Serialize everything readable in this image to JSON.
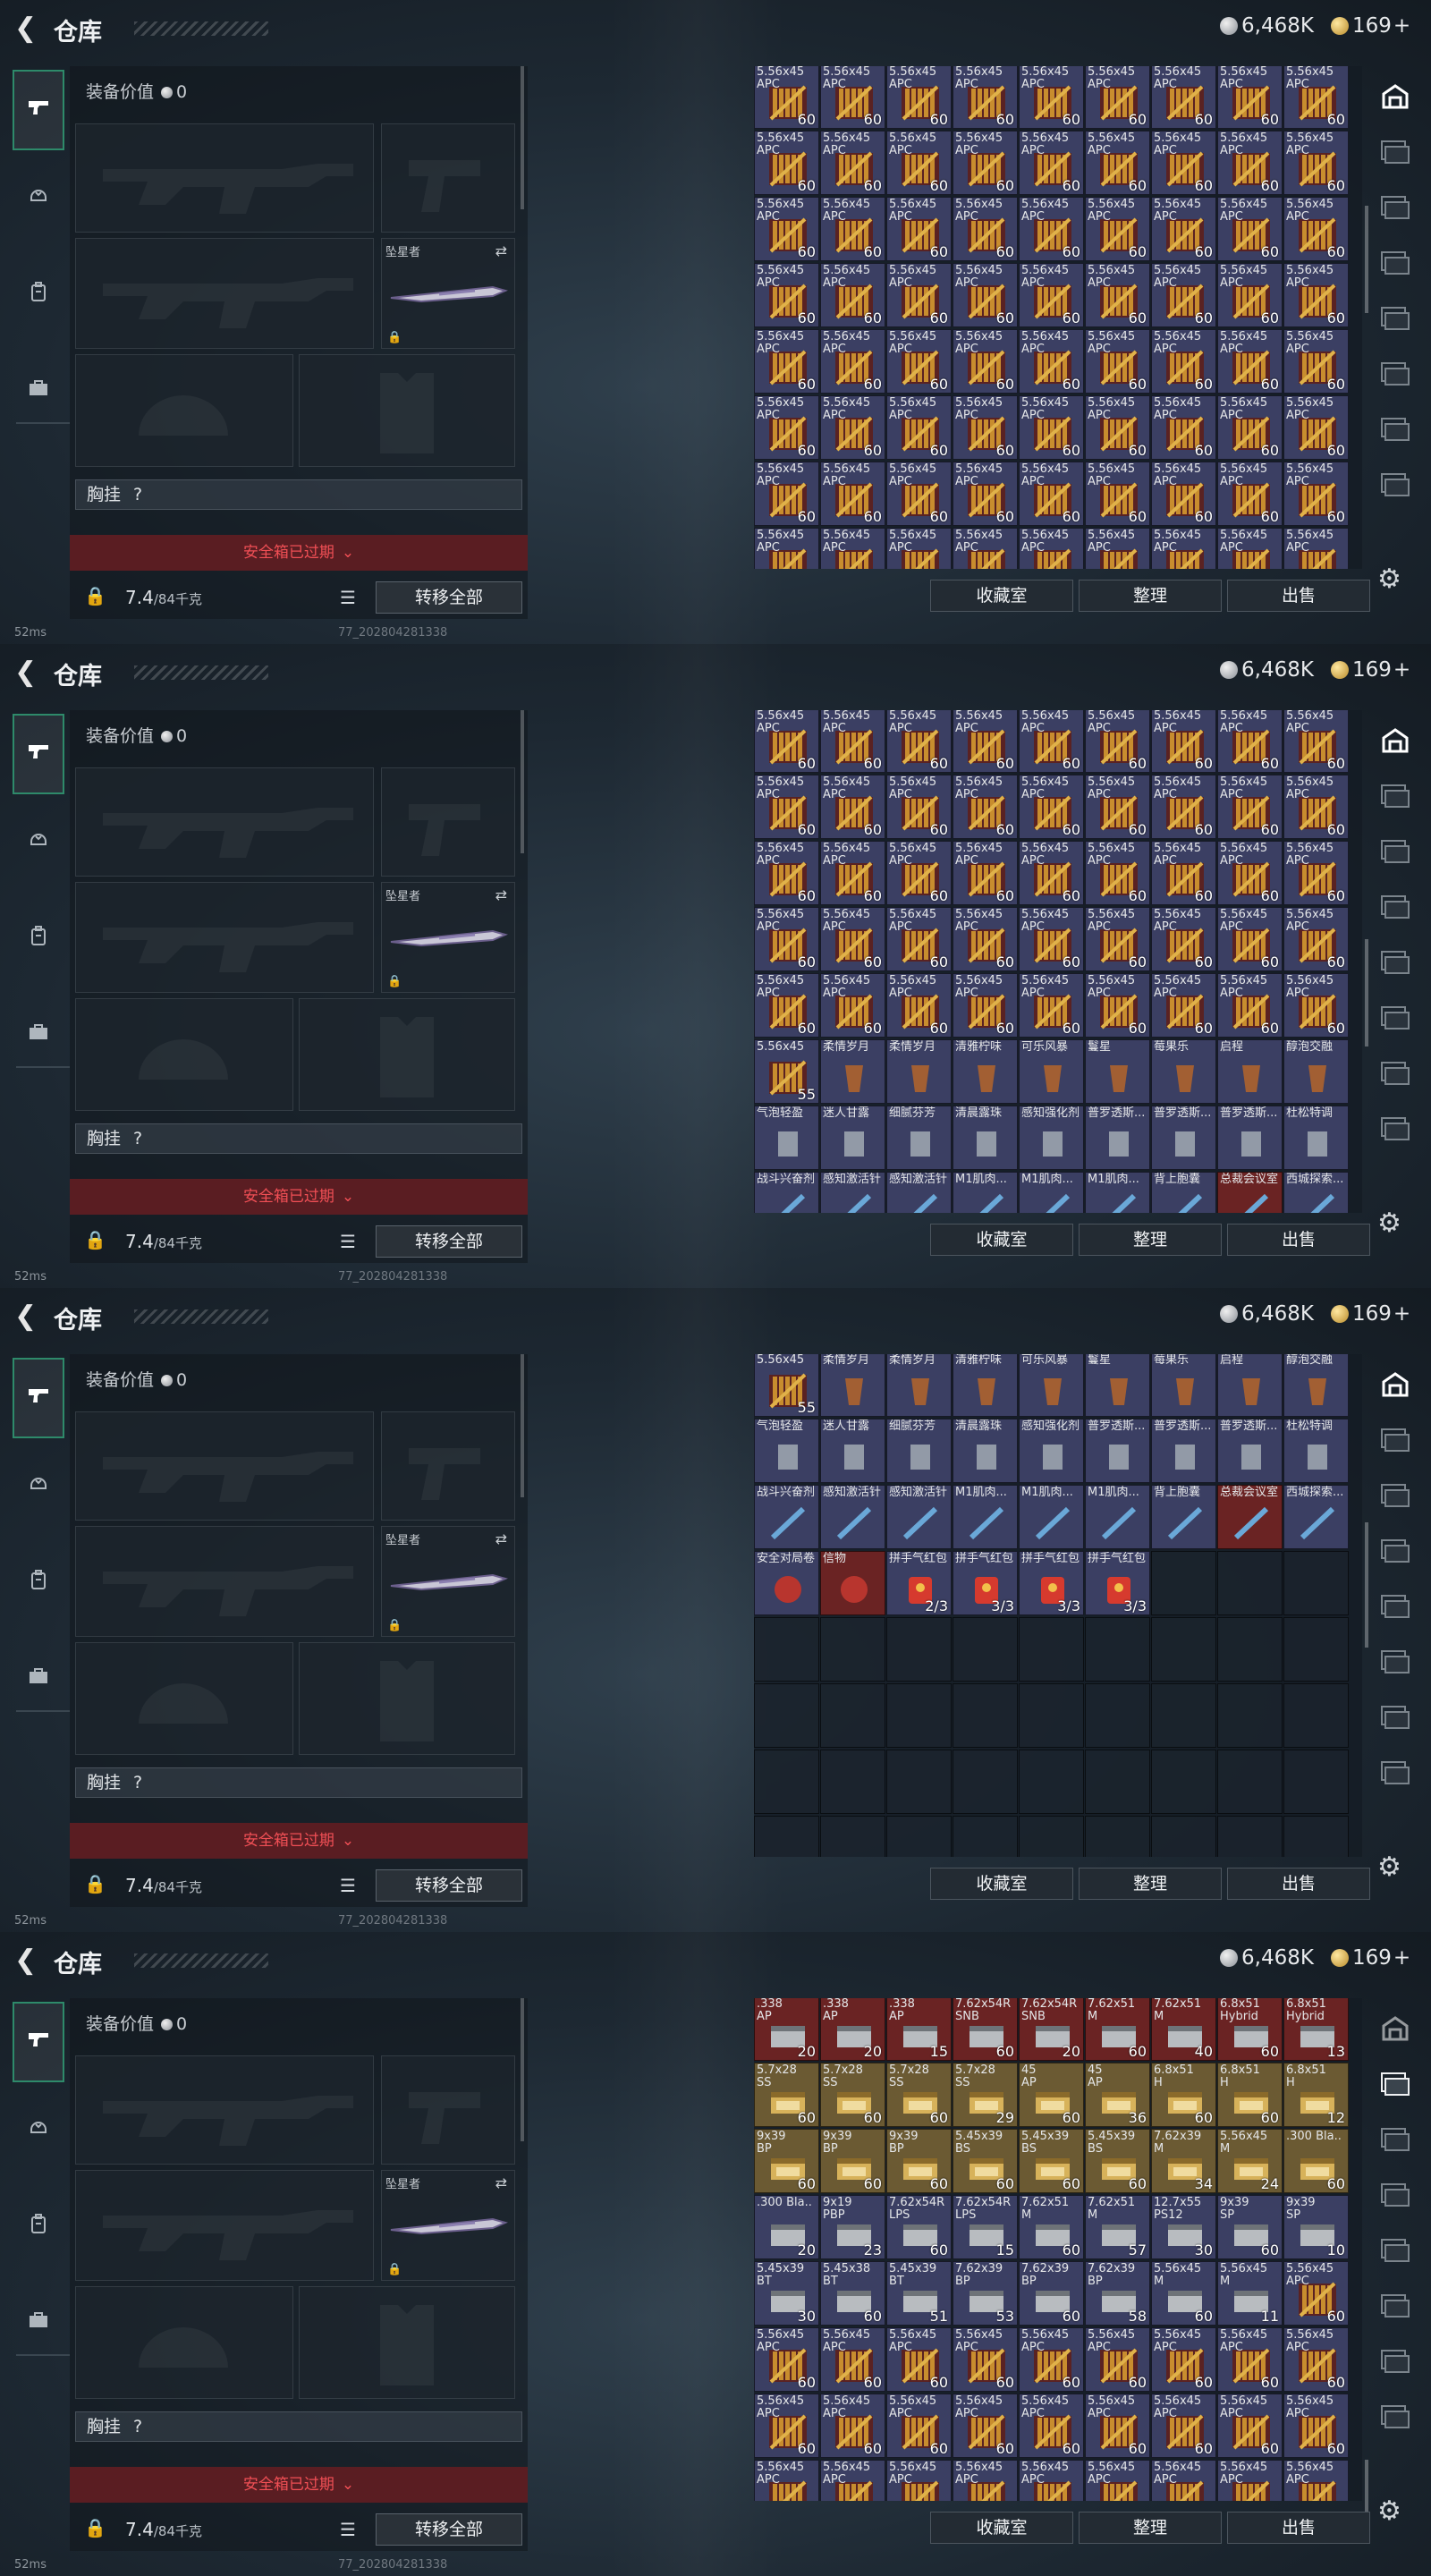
{
  "header": {
    "title": "仓库",
    "silver_amount": "6,468K",
    "gold_amount": "169",
    "gold_plus": "+"
  },
  "equipment": {
    "value_label": "装备价值",
    "value_amount": "0",
    "melee_name": "坠星者",
    "chest_label": "胸挂",
    "chest_help": "?",
    "safebox_text": "安全箱已过期",
    "weight_current": "7.4",
    "weight_max": "/84千克",
    "transfer_all": "转移全部"
  },
  "actions": {
    "collection": "收藏室",
    "organize": "整理",
    "sell": "出售"
  },
  "footer": {
    "ping": "52ms",
    "version": "77_202804281338"
  },
  "ammo": {
    "name_line1": "5.56x45",
    "name_line2": "APC",
    "count_60": "60",
    "count_55": "55"
  },
  "colors": {
    "safebox_bg": "#5a1d22",
    "safebox_text": "#f04f55",
    "active_nav_border": "#2e8a6a",
    "ammo_cell_bg": "#3b3f63",
    "rare_red_bg": "#6a2323",
    "rare_gold_bg": "#6b5a33",
    "rare_green_bg": "#3f5a2e"
  },
  "left_nav_icons": [
    "gun-icon",
    "helmet-icon",
    "backpack-icon",
    "briefcase-icon"
  ],
  "right_rail_icons": [
    "warehouse-icon",
    "cabinet-icon-1",
    "cabinet-icon-2",
    "cabinet-icon-3",
    "cabinet-icon-4",
    "cabinet-icon-5",
    "cabinet-icon-6",
    "cabinet-icon-7"
  ],
  "panel2": {
    "consumables_row1": [
      {
        "name": "5.56x45",
        "count": "55"
      },
      {
        "name": "柔情岁月"
      },
      {
        "name": "柔情岁月"
      },
      {
        "name": "清雅柠味"
      },
      {
        "name": "可乐风暴"
      },
      {
        "name": "鬘星"
      },
      {
        "name": "莓果乐"
      },
      {
        "name": "启程"
      },
      {
        "name": "醇泡交融"
      }
    ],
    "consumables_row2": [
      {
        "name": "气泡轻盈"
      },
      {
        "name": "迷人甘露"
      },
      {
        "name": "细腻芬芳"
      },
      {
        "name": "清晨露珠"
      },
      {
        "name": "感知强化剂"
      },
      {
        "name": "普罗透斯..."
      },
      {
        "name": "普罗透斯..."
      },
      {
        "name": "普罗透斯..."
      },
      {
        "name": "杜松特调"
      }
    ],
    "consumables_row3": [
      {
        "name": "战斗兴奋剂"
      },
      {
        "name": "感知激活针"
      },
      {
        "name": "感知激活针"
      },
      {
        "name": "M1肌肉..."
      },
      {
        "name": "M1肌肉..."
      },
      {
        "name": "M1肌肉..."
      },
      {
        "name": "背上胞囊"
      },
      {
        "name": "总裁会议室"
      },
      {
        "name": "西城探索..."
      }
    ]
  },
  "panel3": {
    "row4": [
      {
        "name": "安全对局卷",
        "count": ""
      },
      {
        "name": "信物",
        "count": ""
      },
      {
        "name": "拼手气红包",
        "count": "2/3"
      },
      {
        "name": "拼手气红包",
        "count": "3/3"
      },
      {
        "name": "拼手气红包",
        "count": "3/3"
      },
      {
        "name": "拼手气红包",
        "count": "3/3"
      }
    ]
  },
  "panel4": {
    "grid": [
      [
        {
          "n": ".338",
          "s": "AP",
          "c": "20",
          "bg": "red"
        },
        {
          "n": ".338",
          "s": "AP",
          "c": "20",
          "bg": "red"
        },
        {
          "n": ".338",
          "s": "AP",
          "c": "15",
          "bg": "red"
        },
        {
          "n": "7.62x54R",
          "s": "SNB",
          "c": "60",
          "bg": "red"
        },
        {
          "n": "7.62x54R",
          "s": "SNB",
          "c": "20",
          "bg": "red"
        },
        {
          "n": "7.62x51",
          "s": "M",
          "c": "60",
          "bg": "red"
        },
        {
          "n": "7.62x51",
          "s": "M",
          "c": "40",
          "bg": "red"
        },
        {
          "n": "6.8x51",
          "s": "Hybrid",
          "c": "60",
          "bg": "red"
        },
        {
          "n": "6.8x51",
          "s": "Hybrid",
          "c": "13",
          "bg": "red"
        }
      ],
      [
        {
          "n": "5.7x28",
          "s": "SS",
          "c": "60",
          "bg": "gold"
        },
        {
          "n": "5.7x28",
          "s": "SS",
          "c": "60",
          "bg": "gold"
        },
        {
          "n": "5.7x28",
          "s": "SS",
          "c": "60",
          "bg": "gold"
        },
        {
          "n": "5.7x28",
          "s": "SS",
          "c": "29",
          "bg": "gold"
        },
        {
          "n": "45",
          "s": "AP",
          "c": "60",
          "bg": "gold"
        },
        {
          "n": "45",
          "s": "AP",
          "c": "36",
          "bg": "gold"
        },
        {
          "n": "6.8x51",
          "s": "H",
          "c": "60",
          "bg": "gold"
        },
        {
          "n": "6.8x51",
          "s": "H",
          "c": "60",
          "bg": "gold"
        },
        {
          "n": "6.8x51",
          "s": "H",
          "c": "12",
          "bg": "gold"
        }
      ],
      [
        {
          "n": "9x39",
          "s": "BP",
          "c": "60",
          "bg": "gold"
        },
        {
          "n": "9x39",
          "s": "BP",
          "c": "60",
          "bg": "gold"
        },
        {
          "n": "9x39",
          "s": "BP",
          "c": "60",
          "bg": "gold"
        },
        {
          "n": "5.45x39",
          "s": "BS",
          "c": "60",
          "bg": "gold"
        },
        {
          "n": "5.45x39",
          "s": "BS",
          "c": "60",
          "bg": "gold"
        },
        {
          "n": "5.45x39",
          "s": "BS",
          "c": "60",
          "bg": "gold"
        },
        {
          "n": "7.62x39",
          "s": "M",
          "c": "34",
          "bg": "gold"
        },
        {
          "n": "5.56x45",
          "s": "M",
          "c": "24",
          "bg": "gold"
        },
        {
          "n": ".300 Bla..",
          "s": "",
          "c": "60",
          "bg": "gold"
        }
      ],
      [
        {
          "n": ".300 Bla..",
          "s": "",
          "c": "20",
          "bg": "blue"
        },
        {
          "n": "9x19",
          "s": "PBP",
          "c": "23",
          "bg": "blue"
        },
        {
          "n": "7.62x54R",
          "s": "LPS",
          "c": "60",
          "bg": "blue"
        },
        {
          "n": "7.62x54R",
          "s": "LPS",
          "c": "15",
          "bg": "blue"
        },
        {
          "n": "7.62x51",
          "s": "M",
          "c": "60",
          "bg": "blue"
        },
        {
          "n": "7.62x51",
          "s": "M",
          "c": "57",
          "bg": "blue"
        },
        {
          "n": "12.7x55",
          "s": "PS12",
          "c": "30",
          "bg": "blue"
        },
        {
          "n": "9x39",
          "s": "SP",
          "c": "60",
          "bg": "blue"
        },
        {
          "n": "9x39",
          "s": "SP",
          "c": "10",
          "bg": "blue"
        }
      ],
      [
        {
          "n": "5.45x39",
          "s": "BT",
          "c": "30",
          "bg": "blue"
        },
        {
          "n": "5.45x38",
          "s": "BT",
          "c": "60",
          "bg": "blue"
        },
        {
          "n": "5.45x39",
          "s": "BT",
          "c": "51",
          "bg": "blue"
        },
        {
          "n": "7.62x39",
          "s": "BP",
          "c": "53",
          "bg": "blue"
        },
        {
          "n": "7.62x39",
          "s": "BP",
          "c": "60",
          "bg": "blue"
        },
        {
          "n": "7.62x39",
          "s": "BP",
          "c": "58",
          "bg": "blue"
        },
        {
          "n": "5.56x45",
          "s": "M",
          "c": "60",
          "bg": "blue"
        },
        {
          "n": "5.56x45",
          "s": "M",
          "c": "11",
          "bg": "blue"
        },
        {
          "n": "5.56x45",
          "s": "APC",
          "c": "60",
          "bg": "blue"
        }
      ]
    ]
  }
}
